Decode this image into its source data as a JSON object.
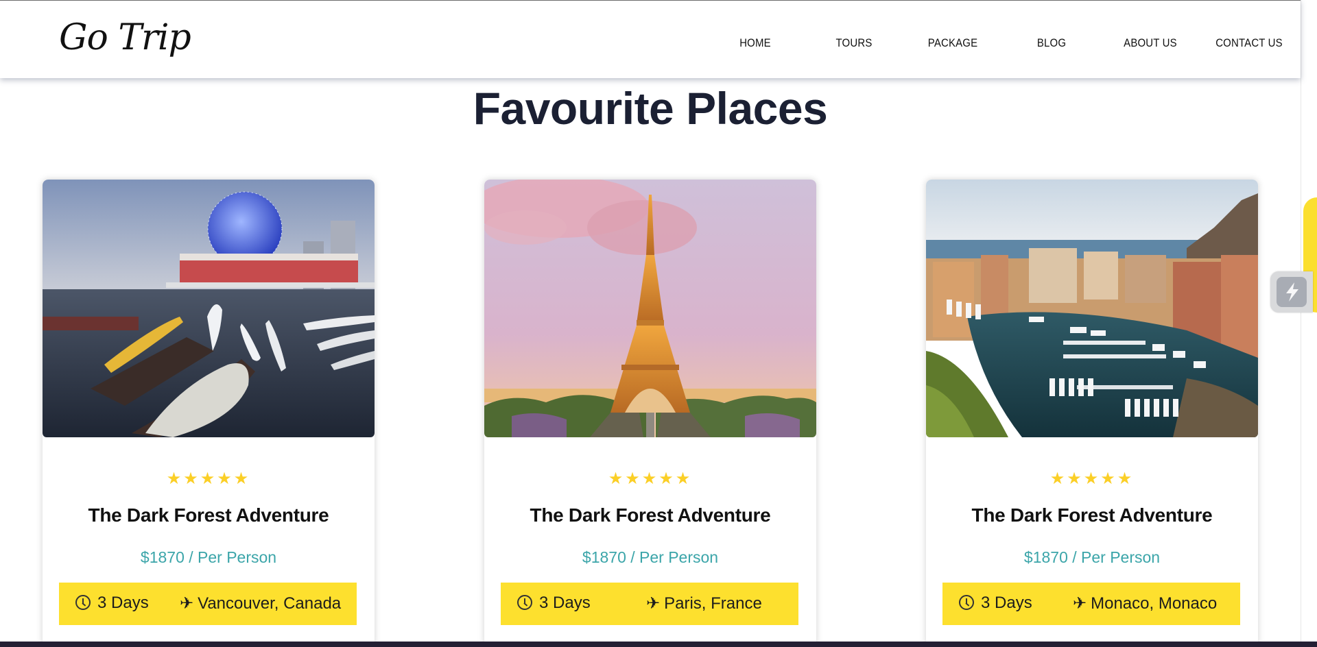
{
  "header": {
    "logo": "Go Trip",
    "nav": [
      {
        "label": "HOME"
      },
      {
        "label": "TOURS"
      },
      {
        "label": "PACKAGE"
      },
      {
        "label": "BLOG"
      },
      {
        "label": "ABOUT US"
      },
      {
        "label": "CONTACT US"
      }
    ]
  },
  "section": {
    "title": "Favourite Places"
  },
  "cards": [
    {
      "stars": "★★★★★",
      "rating": 5,
      "title": "The Dark Forest Adventure",
      "price": "$1870 / Per Person",
      "duration": "3 Days",
      "location": "Vancouver, Canada"
    },
    {
      "stars": "★★★★★",
      "rating": 5,
      "title": "The Dark Forest Adventure",
      "price": "$1870 / Per Person",
      "duration": "3 Days",
      "location": "Paris, France"
    },
    {
      "stars": "★★★★★",
      "rating": 5,
      "title": "The Dark Forest Adventure",
      "price": "$1870 / Per Person",
      "duration": "3 Days",
      "location": "Monaco, Monaco"
    }
  ],
  "icons": {
    "rating": "star-icon",
    "duration": "clock-icon",
    "location": "plane-icon",
    "widget": "lightning-icon"
  },
  "colors": {
    "accent_yellow": "#fde02e",
    "price_teal": "#3ba5a9",
    "title_navy": "#1b2033",
    "star": "#fbcf27"
  }
}
